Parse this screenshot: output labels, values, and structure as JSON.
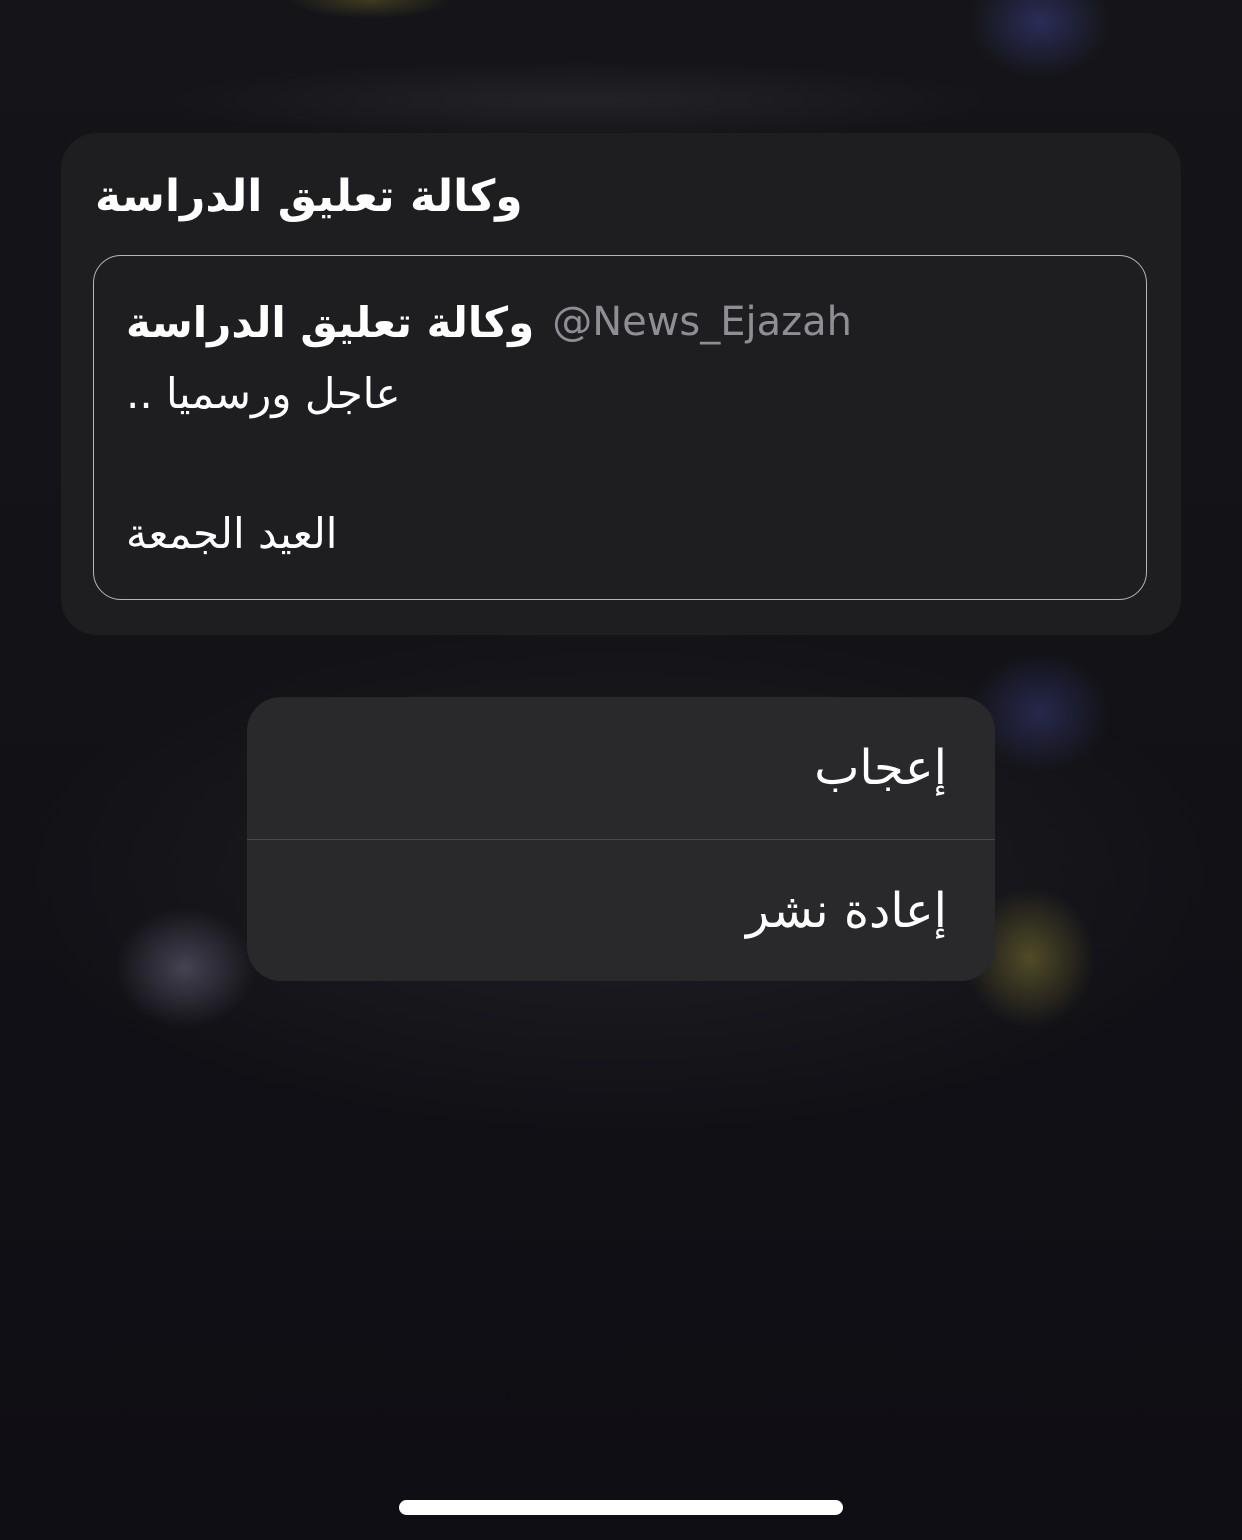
{
  "share_card": {
    "title": "وكالة تعليق الدراسة",
    "tweet": {
      "author": "وكالة تعليق الدراسة",
      "handle": "@News_Ejazah",
      "line_1": "عاجل ورسميا ..",
      "line_2": "العيد الجمعة"
    }
  },
  "context_menu": {
    "items": [
      {
        "label": "إعجاب"
      },
      {
        "label": "إعادة نشر"
      }
    ]
  },
  "colors": {
    "background": "#111016",
    "card": "#1e1e21",
    "menu": "#29292c",
    "handle_gray": "#8e8e93"
  }
}
